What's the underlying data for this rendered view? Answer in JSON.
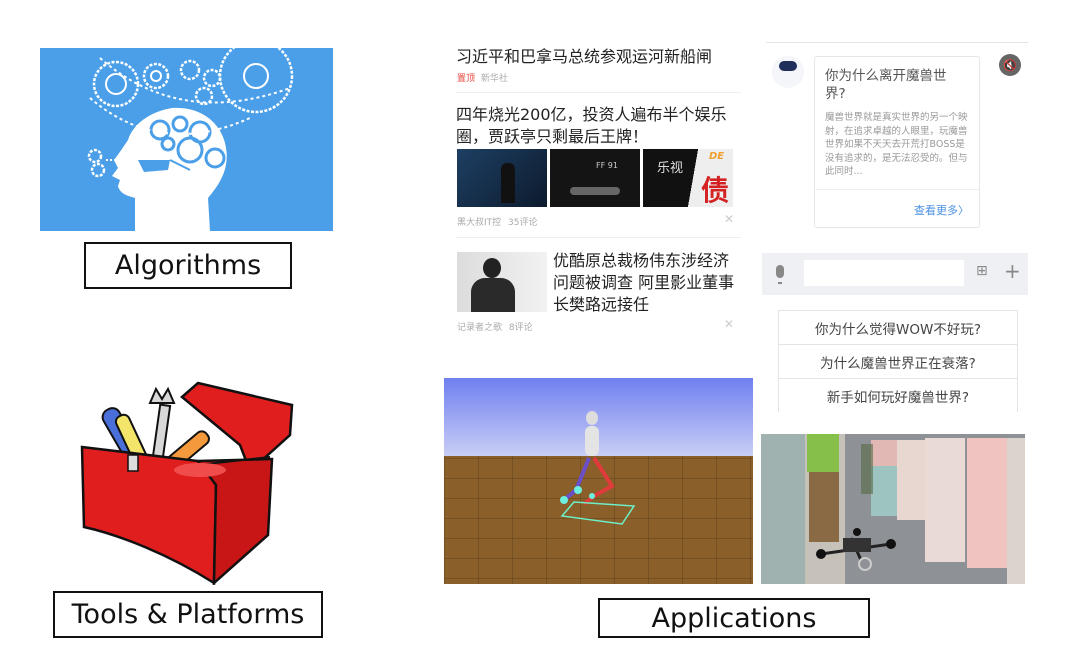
{
  "labels": {
    "algorithms": "Algorithms",
    "tools": "Tools & Platforms",
    "applications": "Applications"
  },
  "news": {
    "items": [
      {
        "title": "习近平和巴拿马总统参观运河新船闸",
        "tag": "置顶",
        "source": "新华社"
      },
      {
        "title": "四年烧光200亿，投资人遍布半个娱乐圈，贾跃亭只剩最后王牌！",
        "source": "黑大叔IT控",
        "comments": "35评论",
        "thumb_texts": [
          "FF 91",
          "乐视",
          "DE",
          "债"
        ]
      },
      {
        "title": "优酷原总裁杨伟东涉经济问题被调查 阿里影业董事长樊路远接任",
        "source": "记录者之歌",
        "comments": "8评论"
      }
    ],
    "tag_color": "#e8453c"
  },
  "chat": {
    "question": "你为什么离开魔兽世界?",
    "answer": "魔兽世界就是真实世界的另一个映射，在追求卓越的人眼里，玩魔兽世界如果不天天去开荒打BOSS是没有追求的，是无法忍受的。但与此同时...",
    "more_link": "查看更多",
    "suggestions": [
      "你为什么觉得WOW不好玩?",
      "为什么魔兽世界正在衰落?",
      "新手如何玩好魔兽世界?"
    ],
    "input_value": "",
    "link_color": "#4a90e2"
  }
}
